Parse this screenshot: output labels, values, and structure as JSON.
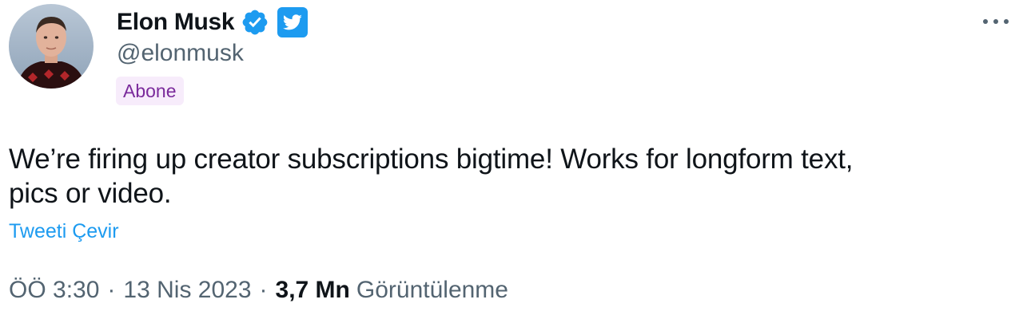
{
  "author": {
    "display_name": "Elon Musk",
    "handle": "@elonmusk",
    "subscribe_label": "Abone",
    "avatar_icon": "profile-photo",
    "verified_icon": "verified-badge-icon",
    "affiliate_icon": "twitter-bird-icon"
  },
  "tweet": {
    "text_lines": [
      "We’re firing up creator subscriptions bigtime! Works for longform text,",
      "pics or video."
    ],
    "translate_label": "Tweeti Çevir"
  },
  "meta": {
    "time": "ÖÖ 3:30",
    "separator": "·",
    "date": "13 Nis 2023",
    "views_count": "3,7 Mn",
    "views_label": "Görüntülenme"
  },
  "colors": {
    "accent": "#1d9bf0",
    "secondary_text": "#536471",
    "primary_text": "#0f1419",
    "subscribe_bg": "#f7ecfb",
    "subscribe_text": "#7a2a9b"
  }
}
